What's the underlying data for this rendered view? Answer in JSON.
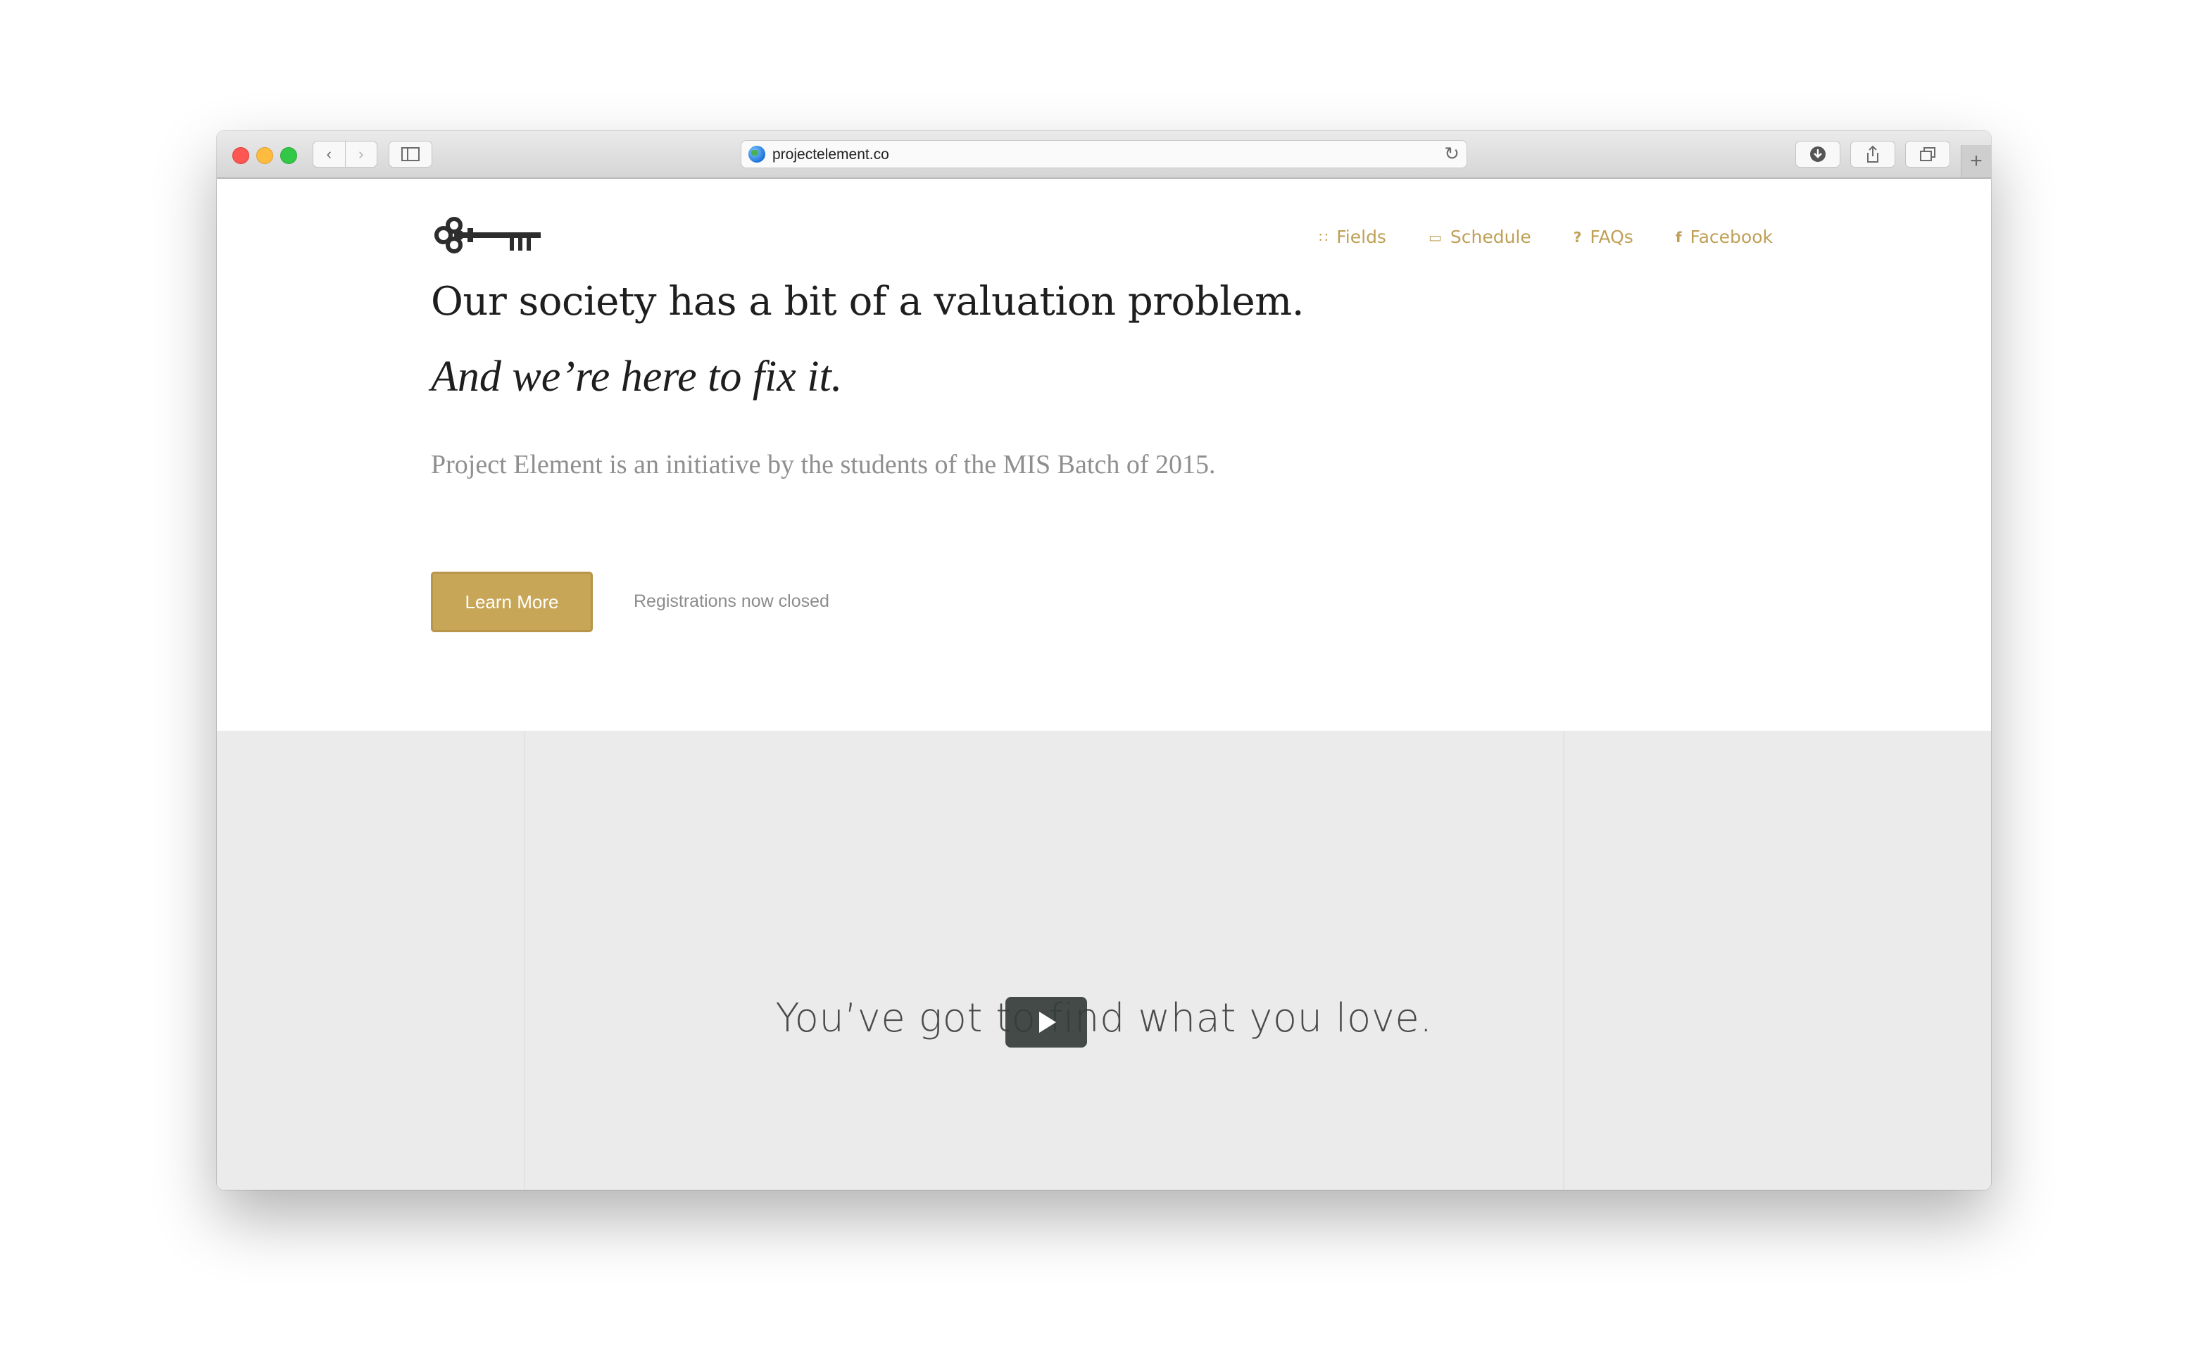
{
  "browser": {
    "url": "projectelement.co",
    "icons": {
      "back": "chevron-left-icon",
      "forward": "chevron-right-icon",
      "sidebar": "sidebar-icon",
      "reload": "reload-icon",
      "download": "download-icon",
      "share": "share-icon",
      "tabs": "tabs-icon",
      "new_tab": "plus-icon"
    }
  },
  "nav": {
    "items": [
      {
        "label": "Fields",
        "icon": "grid-icon"
      },
      {
        "label": "Schedule",
        "icon": "calendar-icon"
      },
      {
        "label": "FAQs",
        "icon": "question-icon"
      },
      {
        "label": "Facebook",
        "icon": "facebook-icon"
      }
    ]
  },
  "hero": {
    "headline": "Our society has a bit of a valuation problem.",
    "subheadline": "And we’re here to fix it.",
    "intro": "Project Element is an initiative by the students of the MIS Batch of 2015.",
    "cta_label": "Learn More",
    "note": "Registrations now closed"
  },
  "video": {
    "caption": "You’ve got to find what you love."
  },
  "colors": {
    "accent": "#c7a657",
    "nav_text": "#c0a056",
    "video_bg": "#ebebeb"
  }
}
